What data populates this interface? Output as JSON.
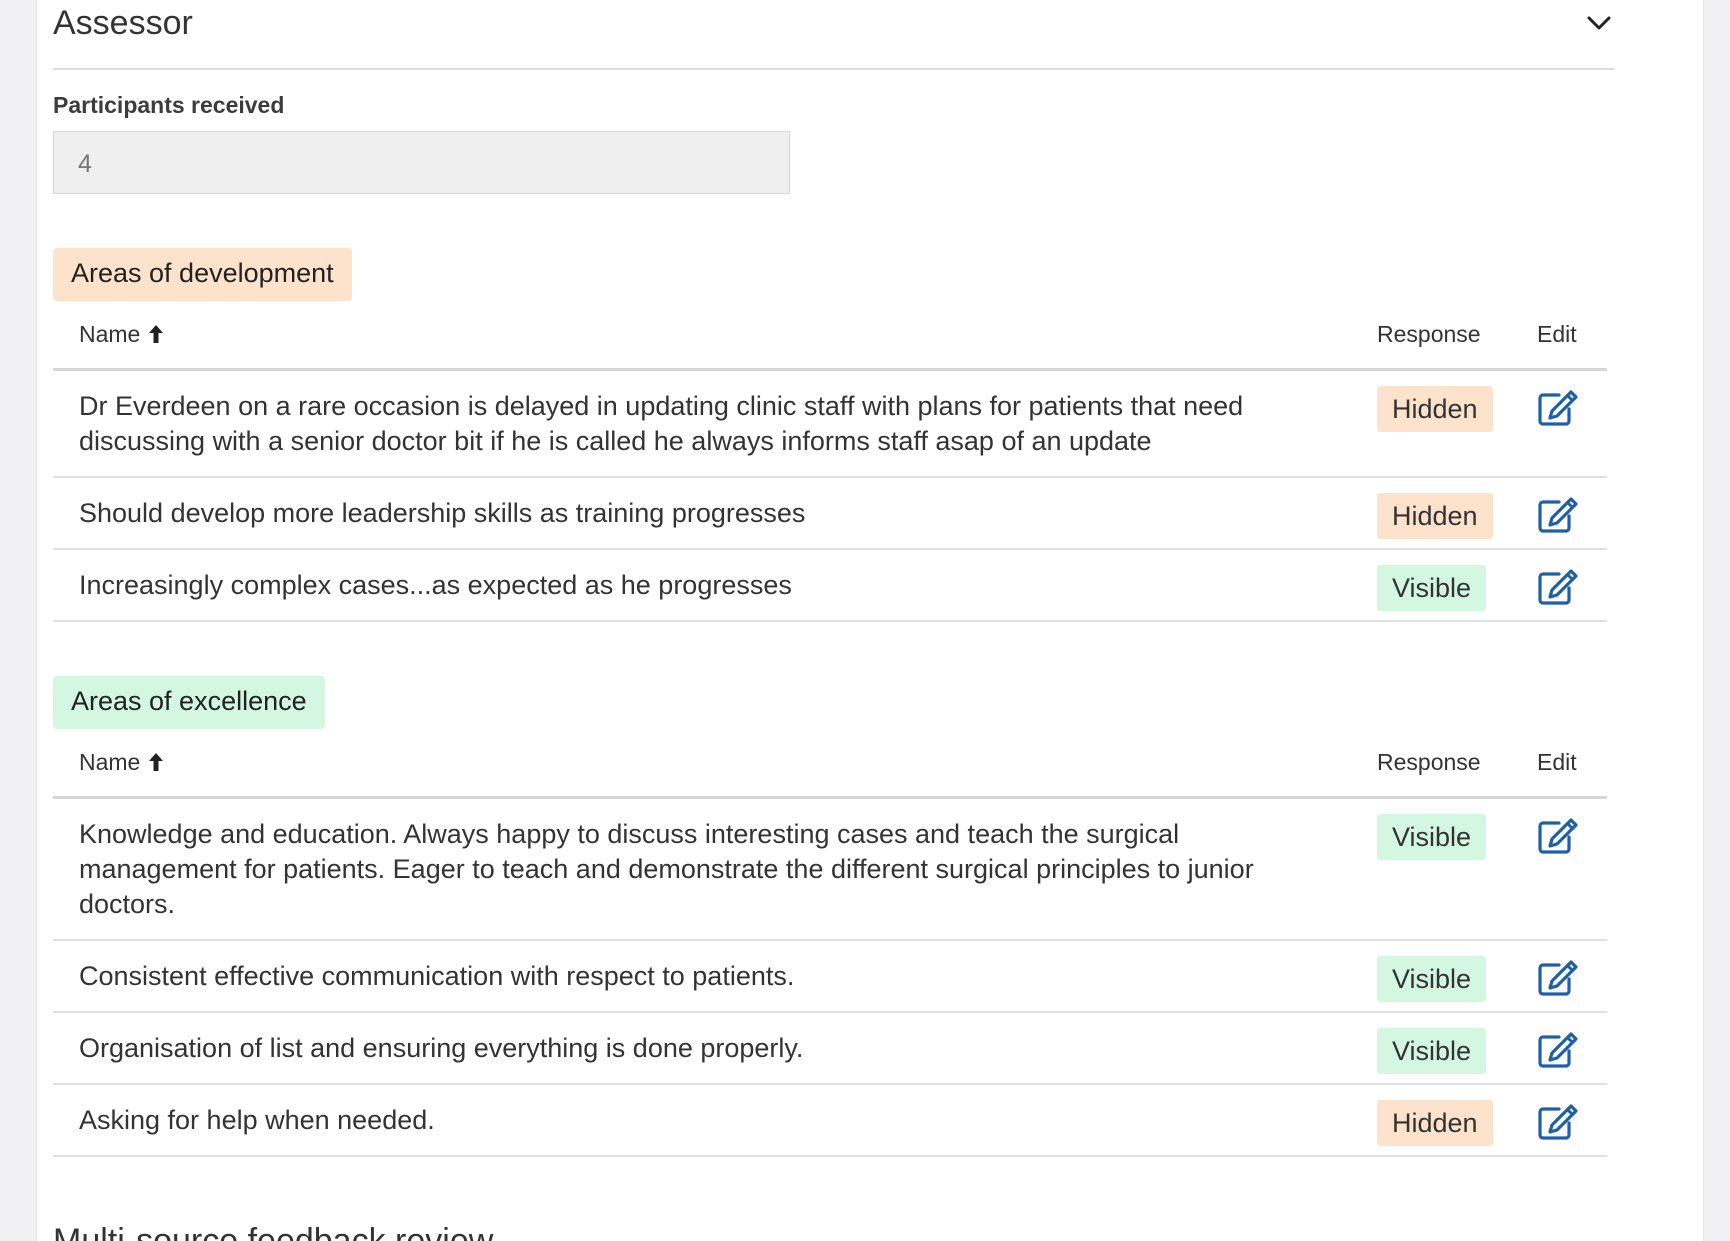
{
  "section": {
    "title": "Assessor",
    "next_title": "Multi-source feedback review"
  },
  "participants": {
    "label": "Participants received",
    "value": "4"
  },
  "table_headers": {
    "name": "Name",
    "response": "Response",
    "edit": "Edit"
  },
  "development": {
    "tag": "Areas of development",
    "rows": [
      {
        "text": "Dr Everdeen on a rare occasion is delayed in updating clinic staff with plans for patients that need discussing with a senior doctor bit if he is called he always informs staff asap of an update",
        "response": "Hidden"
      },
      {
        "text": "Should develop more leadership skills as training progresses",
        "response": "Hidden"
      },
      {
        "text": "Increasingly complex cases...as expected as he progresses",
        "response": "Visible"
      }
    ]
  },
  "excellence": {
    "tag": "Areas of excellence",
    "rows": [
      {
        "text": "Knowledge and education. Always happy to discuss interesting cases and teach the surgical management for patients. Eager to teach and demonstrate the different surgical principles to junior doctors.",
        "response": "Visible"
      },
      {
        "text": "Consistent effective communication with respect to patients.",
        "response": "Visible"
      },
      {
        "text": "Organisation of list and ensuring everything is done properly.",
        "response": "Visible"
      },
      {
        "text": "Asking for help when needed.",
        "response": "Hidden"
      }
    ]
  },
  "colors": {
    "hidden_bg": "#fde3cc",
    "visible_bg": "#d3f7e0",
    "edit_icon": "#1f5fa6"
  },
  "icons": {
    "chevron": "chevron-down-icon",
    "sort": "arrow-up-icon",
    "edit": "edit-icon"
  }
}
